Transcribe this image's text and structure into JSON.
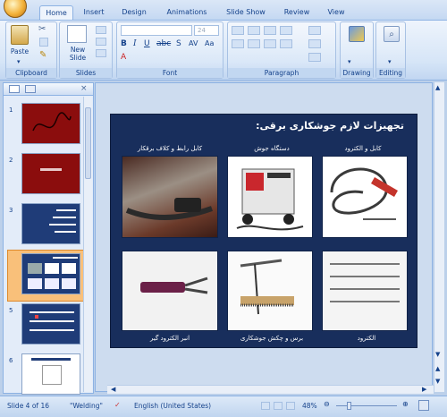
{
  "ribbon": {
    "tabs": [
      "Home",
      "Insert",
      "Design",
      "Animations",
      "Slide Show",
      "Review",
      "View"
    ],
    "clipboard": {
      "paste": "Paste",
      "label": "Clipboard"
    },
    "slides": {
      "new_slide": "New Slide",
      "label": "Slides"
    },
    "font": {
      "size": "24",
      "label": "Font"
    },
    "paragraph": {
      "label": "Paragraph"
    },
    "drawing": {
      "label": "Drawing"
    },
    "editing": {
      "label": "Editing"
    }
  },
  "thumbnails": [
    {
      "num": "1",
      "bg": "#8b0d0d"
    },
    {
      "num": "2",
      "bg": "#8b0d0d"
    },
    {
      "num": "3",
      "bg": "#1f3c78"
    },
    {
      "num": "4",
      "bg": "#1f3c78"
    },
    {
      "num": "5",
      "bg": "#1f3c78"
    },
    {
      "num": "6",
      "bg": "#ffffff"
    }
  ],
  "slide": {
    "title": "تجهیزات لازم جوشکاری برقی:",
    "captions": [
      "کابل رابط و کلاف برقکار",
      "دستگاه جوش",
      "کابل و الکترود",
      "انبر الکترود گیر",
      "برس و چکش جوشکاری",
      "الکترود"
    ]
  },
  "status": {
    "slide_info": "Slide 4 of 16",
    "theme": "\"Welding\"",
    "language": "English (United States)",
    "zoom": "48%"
  }
}
